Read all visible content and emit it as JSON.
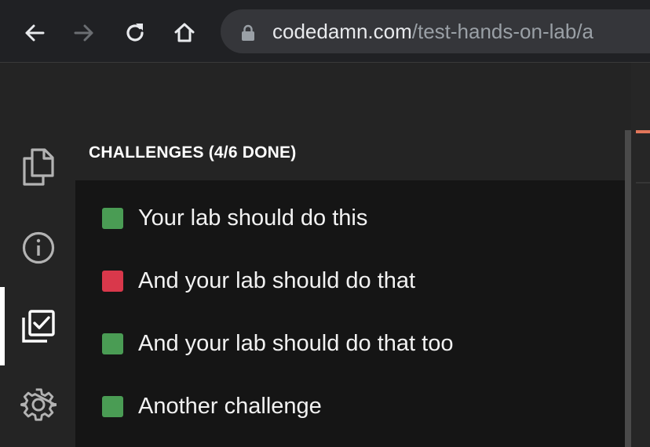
{
  "browser": {
    "url_host": "codedamn.com",
    "url_path": "/test-hands-on-lab/a",
    "nav": {
      "back_icon": "back-arrow-icon",
      "forward_icon": "forward-arrow-icon",
      "reload_icon": "reload-icon",
      "home_icon": "home-icon",
      "lock_icon": "lock-icon"
    }
  },
  "sidebar": {
    "icons": [
      "files-icon",
      "info-icon",
      "challenges-checklist-icon",
      "settings-gear-icon"
    ],
    "active": "challenges-checklist-icon"
  },
  "panel": {
    "title": "CHALLENGES (4/6 DONE)",
    "challenges": [
      {
        "label": "Your lab should do this",
        "status": "passed",
        "color": "#4a9c54"
      },
      {
        "label": "And your lab should do that",
        "status": "failed",
        "color": "#d9384b"
      },
      {
        "label": "And your lab should do that too",
        "status": "passed",
        "color": "#4a9c54"
      },
      {
        "label": "Another challenge",
        "status": "passed",
        "color": "#4a9c54"
      }
    ]
  },
  "colors": {
    "passed": "#4a9c54",
    "failed": "#d9384b",
    "accent": "#e2765a"
  }
}
